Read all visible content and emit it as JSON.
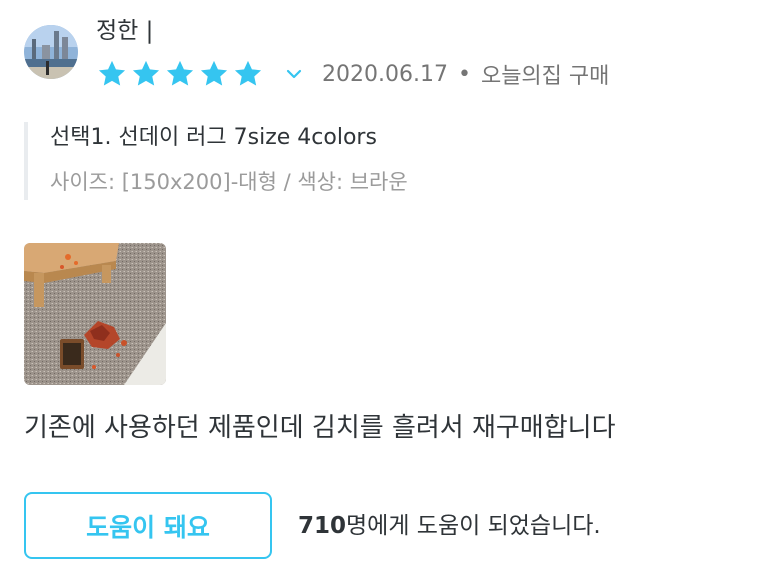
{
  "user": {
    "name": "정한 |",
    "avatar_icon": "profile-photo-icon"
  },
  "rating": {
    "stars": 5,
    "max": 5,
    "star_color": "#35c5f0",
    "date": "2020.06.17",
    "separator": "•",
    "source": "오늘의집 구매"
  },
  "option": {
    "name": "선택1. 선데이 러그 7size 4colors",
    "detail": "사이즈: [150x200]-대형 / 색상: 브라운"
  },
  "photo": {
    "icon": "review-photo-icon"
  },
  "review": {
    "text": "기존에 사용하던 제품인데 김치를 흘려서 재구매합니다"
  },
  "helpful": {
    "button_label": "도움이 돼요",
    "count": "710",
    "count_suffix": "명에게 도움이 되었습니다.",
    "accent_color": "#35c5f0"
  }
}
